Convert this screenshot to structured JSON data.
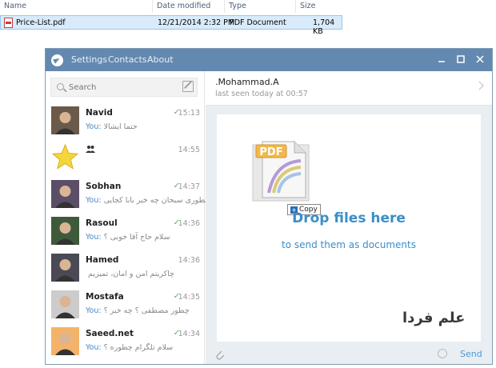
{
  "explorer": {
    "columns": [
      "Name",
      "Date modified",
      "Type",
      "Size"
    ],
    "file": {
      "name": "Price-List.pdf",
      "date": "12/21/2014 2:32 PM",
      "type": "PDF Document",
      "size": "1,704 KB"
    }
  },
  "window": {
    "menu": [
      "Settings",
      "Contacts",
      "About"
    ],
    "controls": [
      "minimize-icon",
      "maximize-icon",
      "close-icon"
    ]
  },
  "search": {
    "placeholder": "Search"
  },
  "chats": [
    {
      "name": "Navid",
      "time": "15:13",
      "you": "You:",
      "preview": "حتما ایشالا",
      "read": true,
      "avatar_color": "#6b5a4a"
    },
    {
      "name": "",
      "time": "14:55",
      "you": "",
      "preview": "",
      "read": false,
      "group": true,
      "avatar_color": "#f5d63a"
    },
    {
      "name": "Sobhan",
      "time": "14:37",
      "you": "You:",
      "preview": "چطوری سبحان چه خبر بابا کجایی",
      "read": true,
      "avatar_color": "#5a4f66"
    },
    {
      "name": "Rasoul",
      "time": "14:36",
      "you": "You:",
      "preview": "سلام حاج آقا خوبی ؟",
      "read": true,
      "avatar_color": "#3f5a3a"
    },
    {
      "name": "Hamed",
      "time": "14:36",
      "you": "",
      "preview": "چاکریتم امن و امان، تمیزیم",
      "read": false,
      "avatar_color": "#4a4a55"
    },
    {
      "name": "Mostafa",
      "time": "14:35",
      "you": "You:",
      "preview": "چطور مصطفی ؟ چه خبر ؟",
      "read": true,
      "avatar_color": "#cccccc"
    },
    {
      "name": "Saeed.net",
      "time": "14:34",
      "you": "You:",
      "preview": "سلام تلگرام چطوره ؟",
      "read": true,
      "avatar_color": "#f3b36a"
    }
  ],
  "peer": {
    "name": ".Mohammad.A",
    "status": "last seen today at 00:57"
  },
  "drop": {
    "title": "Drop files here",
    "subtitle": "to send them as documents",
    "icon_label": "PDF",
    "copy_label": "Copy"
  },
  "watermark": "علم فردا",
  "composer": {
    "send_label": "Send"
  },
  "colors": {
    "titlebar": "#6389b0",
    "accent": "#3a8ec9",
    "check": "#5ab55a"
  }
}
